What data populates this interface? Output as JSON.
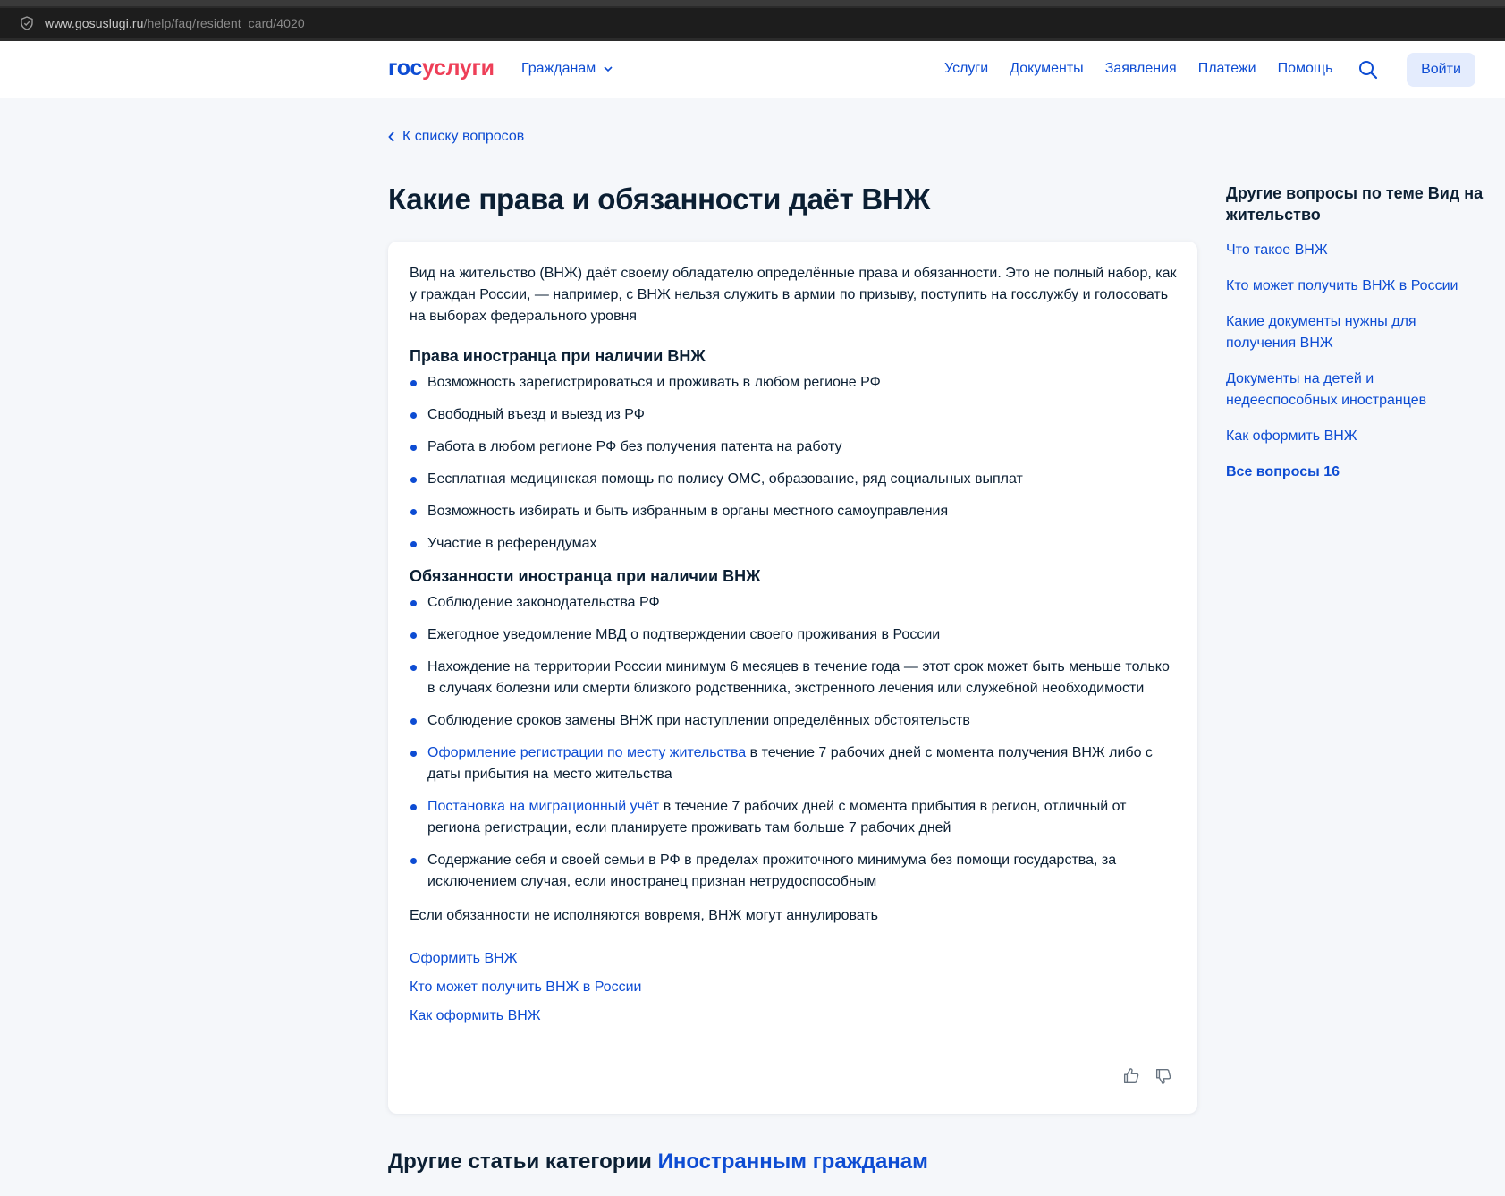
{
  "browser": {
    "url_domain": "www.gosuslugi.ru",
    "url_path": "/help/faq/resident_card/4020"
  },
  "header": {
    "logo_part1": "гос",
    "logo_part2": "услуги",
    "audience": "Гражданам",
    "nav": [
      "Услуги",
      "Документы",
      "Заявления",
      "Платежи",
      "Помощь"
    ],
    "login": "Войти"
  },
  "back_link": "К списку вопросов",
  "title": "Какие права и обязанности даёт ВНЖ",
  "article": {
    "intro": "Вид на жительство (ВНЖ) даёт своему обладателю определённые права и обязанности. Это не полный набор, как у граждан России, — например, с ВНЖ нельзя служить в армии по призыву, поступить на госслужбу и голосовать на выборах федерального уровня",
    "rights_title": "Права иностранца при наличии ВНЖ",
    "rights": [
      "Возможность зарегистрироваться и проживать в любом регионе РФ",
      "Свободный въезд и выезд из РФ",
      "Работа в любом регионе РФ без получения патента на работу",
      "Бесплатная медицинская помощь по полису ОМС, образование, ряд социальных выплат",
      "Возможность избирать и быть избранным в органы местного самоуправления",
      "Участие в референдумах"
    ],
    "duties_title": "Обязанности иностранца при наличии ВНЖ",
    "duties": [
      "Соблюдение законодательства РФ",
      "Ежегодное уведомление МВД о подтверждении своего проживания в России",
      "Нахождение на территории России минимум 6 месяцев в течение года — этот срок может быть меньше только в случаях болезни или смерти близкого родственника, экстренного лечения или служебной необходимости",
      "Соблюдение сроков замены ВНЖ при наступлении определённых обстоятельств"
    ],
    "duty_reg_link": "Оформление регистрации по месту жительства",
    "duty_reg_text": " в течение 7 рабочих дней с момента получения ВНЖ либо с даты прибытия на место жительства",
    "duty_migr_link": "Постановка на миграционный учёт",
    "duty_migr_text": " в течение 7 рабочих дней с момента прибытия в регион, отличный от региона регистрации, если планируете проживать там больше 7 рабочих дней",
    "duty_last": "Содержание себя и своей семьи в РФ в пределах прожиточного минимума без помощи государства, за исключением случая, если иностранец признан нетрудоспособным",
    "outro": "Если обязанности не исполняются вовремя, ВНЖ могут аннулировать",
    "links": [
      "Оформить ВНЖ",
      "Кто может получить ВНЖ в России",
      "Как оформить ВНЖ"
    ]
  },
  "sidebar": {
    "title": "Другие вопросы по теме Вид на жительство",
    "items": [
      "Что такое ВНЖ",
      "Кто может получить ВНЖ в России",
      "Какие документы нужны для получения ВНЖ",
      "Документы на детей и недееспособных иностранцев",
      "Как оформить ВНЖ"
    ],
    "all": "Все вопросы 16"
  },
  "bottom": {
    "prefix": "Другие статьи категории ",
    "link": "Иностранным гражданам"
  },
  "colors": {
    "brand_blue": "#0d4cd3",
    "brand_red": "#ee3f58",
    "text": "#0b1f33",
    "background": "#f5f7fa"
  }
}
